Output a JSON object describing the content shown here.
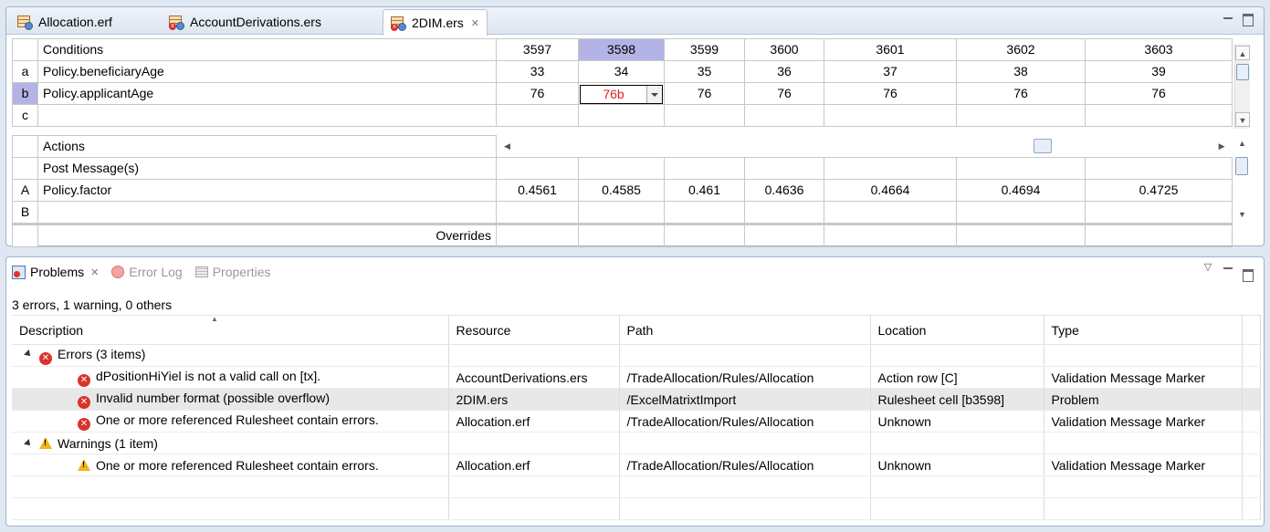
{
  "editor": {
    "tabs": [
      {
        "label": "Allocation.erf",
        "active": false,
        "icon": "rulesheet-flow-icon"
      },
      {
        "label": "AccountDerivations.ers",
        "active": false,
        "icon": "rulesheet-icon"
      },
      {
        "label": "2DIM.ers",
        "active": true,
        "icon": "rulesheet-error-icon"
      }
    ],
    "conditions_header": "Conditions",
    "actions_header": "Actions",
    "post_message_label": "Post Message(s)",
    "overrides_label": "Overrides",
    "columns": [
      "3597",
      "3598",
      "3599",
      "3600",
      "3601",
      "3602",
      "3603"
    ],
    "selected_column": "3598",
    "condition_rows": [
      {
        "id": "a",
        "label": "Policy.beneficiaryAge",
        "values": [
          "33",
          "34",
          "35",
          "36",
          "37",
          "38",
          "39"
        ]
      },
      {
        "id": "b",
        "label": "Policy.applicantAge",
        "values": [
          "76",
          "76b",
          "76",
          "76",
          "76",
          "76",
          "76"
        ]
      },
      {
        "id": "c",
        "label": "",
        "values": [
          "",
          "",
          "",
          "",
          "",
          "",
          ""
        ]
      }
    ],
    "action_rows": [
      {
        "id": "A",
        "label": "Policy.factor",
        "values": [
          "0.4561",
          "0.4585",
          "0.461",
          "0.4636",
          "0.4664",
          "0.4694",
          "0.4725"
        ]
      },
      {
        "id": "B",
        "label": "",
        "values": [
          "",
          "",
          "",
          "",
          "",
          "",
          ""
        ]
      }
    ]
  },
  "problems": {
    "tabs": [
      {
        "label": "Problems",
        "active": true,
        "icon": "problems-icon"
      },
      {
        "label": "Error Log",
        "active": false,
        "icon": "error-log-icon"
      },
      {
        "label": "Properties",
        "active": false,
        "icon": "properties-icon"
      }
    ],
    "summary": "3 errors, 1 warning, 0 others",
    "columns": [
      "Description",
      "Resource",
      "Path",
      "Location",
      "Type"
    ],
    "groups": [
      {
        "label": "Errors (3 items)",
        "severity": "error",
        "items": [
          {
            "description": "dPositionHiYiel is not a valid call on [tx].",
            "resource": "AccountDerivations.ers",
            "path": "/TradeAllocation/Rules/Allocation",
            "location": "Action row [C]",
            "type": "Validation Message Marker"
          },
          {
            "description": "Invalid number format (possible overflow)",
            "resource": "2DIM.ers",
            "path": "/ExcelMatrixtImport",
            "location": "Rulesheet cell [b3598]",
            "type": "Problem"
          },
          {
            "description": "One or more referenced Rulesheet contain errors.",
            "resource": "Allocation.erf",
            "path": "/TradeAllocation/Rules/Allocation",
            "location": "Unknown",
            "type": "Validation Message Marker"
          }
        ]
      },
      {
        "label": "Warnings (1 item)",
        "severity": "warning",
        "items": [
          {
            "description": "One or more referenced Rulesheet contain errors.",
            "resource": "Allocation.erf",
            "path": "/TradeAllocation/Rules/Allocation",
            "location": "Unknown",
            "type": "Validation Message Marker"
          }
        ]
      }
    ]
  },
  "colors": {
    "selection": "#b3b3e6",
    "error_text": "#e02020",
    "error_icon": "#d9342b",
    "warning_icon": "#f2b41f"
  }
}
